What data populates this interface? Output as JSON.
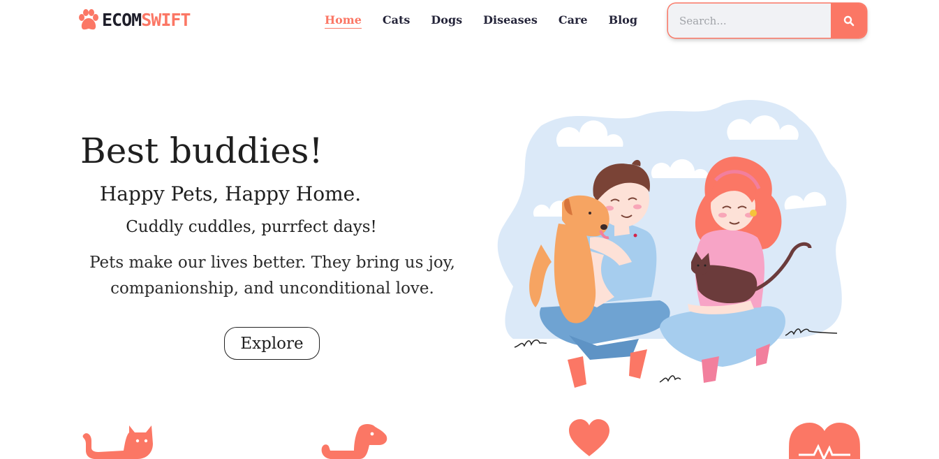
{
  "brand": {
    "part1": "ECOM",
    "part2": "SWIFT"
  },
  "nav": [
    {
      "label": "Home",
      "active": true
    },
    {
      "label": "Cats",
      "active": false
    },
    {
      "label": "Dogs",
      "active": false
    },
    {
      "label": "Diseases",
      "active": false
    },
    {
      "label": "Care",
      "active": false
    },
    {
      "label": "Blog",
      "active": false
    }
  ],
  "search": {
    "placeholder": "Search...",
    "value": ""
  },
  "hero": {
    "title": "Best buddies!",
    "subtitle": "Happy Pets, Happy Home.",
    "tagline": "Cuddly cuddles, purrfect days!",
    "text": "Pets make our lives better. They bring us joy, companionship, and unconditional love.",
    "button": "Explore"
  },
  "icons": [
    "paw-icon",
    "search-icon",
    "cat-icon",
    "dog-icon",
    "heart-icon",
    "heartbeat-icon"
  ],
  "colors": {
    "accent": "#fb7765",
    "dark": "#25253a",
    "sky": "#dbe9f8"
  }
}
